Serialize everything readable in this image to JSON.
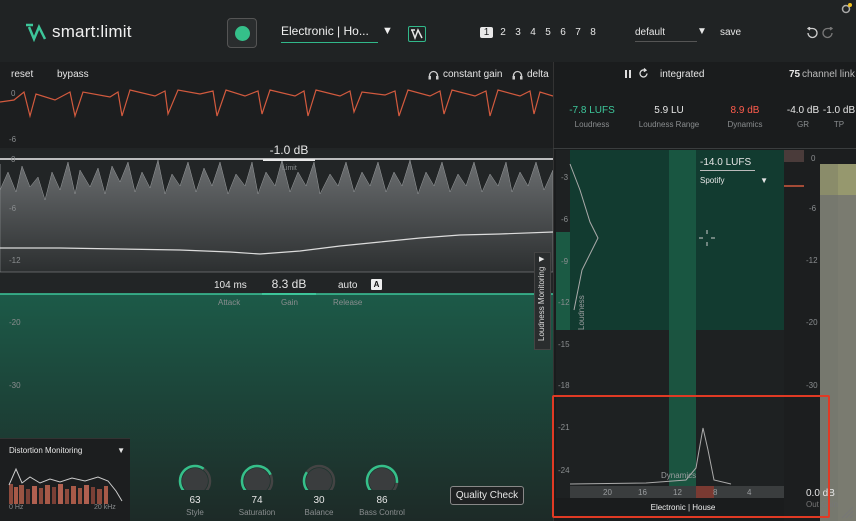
{
  "header": {
    "app_title": "smart:limit",
    "profile": "Electronic | Ho...",
    "presets": [
      "1",
      "2",
      "3",
      "4",
      "5",
      "6",
      "7",
      "8"
    ],
    "preset_name": "default",
    "save_label": "save"
  },
  "topbar": {
    "reset_label": "reset",
    "bypass_label": "bypass",
    "constant_gain_label": "constant gain",
    "delta_label": "delta",
    "integrated_label": "integrated",
    "channel_link_value": "75",
    "channel_link_label": "channel link"
  },
  "metrics": {
    "loudness": {
      "value": "-7.8 LUFS",
      "label": "Loudness"
    },
    "loudness_range": {
      "value": "5.9 LU",
      "label": "Loudness Range"
    },
    "dynamics": {
      "value": "8.9 dB",
      "label": "Dynamics"
    },
    "gr": {
      "value": "-4.0 dB",
      "label": "GR"
    },
    "tp": {
      "value": "-1.0 dB",
      "label": "TP"
    }
  },
  "limit": {
    "value": "-1.0 dB",
    "label": "Limit"
  },
  "gain_controls": {
    "attack_value": "104 ms",
    "attack_label": "Attack",
    "gain_value": "8.3 dB",
    "gain_label": "Gain",
    "release_value": "auto",
    "release_label": "Release",
    "auto_badge": "A"
  },
  "left_axis": {
    "top_scale": [
      "0",
      "-6"
    ],
    "main_scale": [
      "0",
      "-6",
      "-12",
      "-20",
      "-30"
    ]
  },
  "right_panel": {
    "loudness_monitoring_label": "Loudness Monitoring",
    "target_lufs": "-14.0 LUFS",
    "platform": "Spotify",
    "loudness_axis_label": "Loudness",
    "dynamics_axis_label": "Dynamics",
    "y_scale": [
      "-3",
      "-6",
      "-9",
      "-12",
      "-15",
      "-18",
      "-21",
      "-24"
    ],
    "x_scale": [
      "20",
      "16",
      "12",
      "8",
      "4"
    ],
    "genre": "Electronic | House",
    "meter_scale": [
      "0",
      "-6",
      "-12",
      "-20",
      "-30"
    ],
    "out_gain_value": "0.0 dB",
    "out_gain_label": "Out Gain"
  },
  "distortion": {
    "label": "Distortion Monitoring",
    "hz_low": "0 Hz",
    "hz_high": "20 kHz"
  },
  "knobs": [
    {
      "name": "Style",
      "value": "63",
      "level": 0.63
    },
    {
      "name": "Saturation",
      "value": "74",
      "level": 0.74
    },
    {
      "name": "Balance",
      "value": "30",
      "level": 0.3
    },
    {
      "name": "Bass Control",
      "value": "86",
      "level": 0.86
    }
  ],
  "quality_check_label": "Quality Check",
  "colors": {
    "accent": "#35c08a",
    "dynamics_red": "#ff5c4d",
    "highlight": "#e03a24"
  }
}
